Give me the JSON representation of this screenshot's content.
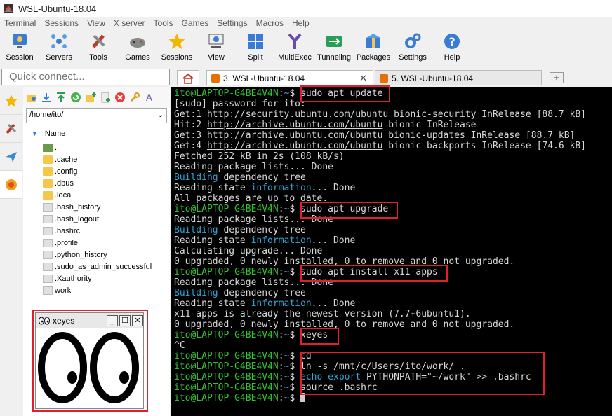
{
  "window": {
    "title": "WSL-Ubuntu-18.04"
  },
  "menu": [
    "Terminal",
    "Sessions",
    "View",
    "X server",
    "Tools",
    "Games",
    "Settings",
    "Macros",
    "Help"
  ],
  "toolbar": [
    {
      "label": "Session",
      "icon": "session-icon"
    },
    {
      "label": "Servers",
      "icon": "servers-icon"
    },
    {
      "label": "Tools",
      "icon": "tools-icon"
    },
    {
      "label": "Games",
      "icon": "games-icon"
    },
    {
      "label": "Sessions",
      "icon": "star-icon"
    },
    {
      "label": "View",
      "icon": "view-icon"
    },
    {
      "label": "Split",
      "icon": "split-icon"
    },
    {
      "label": "MultiExec",
      "icon": "multiexec-icon"
    },
    {
      "label": "Tunneling",
      "icon": "tunneling-icon"
    },
    {
      "label": "Packages",
      "icon": "packages-icon"
    },
    {
      "label": "Settings",
      "icon": "gear-icon"
    },
    {
      "label": "Help",
      "icon": "help-icon"
    }
  ],
  "quick_connect": {
    "placeholder": "Quick connect..."
  },
  "tabs": [
    {
      "label": "3. WSL-Ubuntu-18.04",
      "active": true
    },
    {
      "label": "5. WSL-Ubuntu-18.04",
      "active": false
    }
  ],
  "filebrowser": {
    "path": "/home/ito/",
    "column_header": "Name",
    "files": [
      {
        "name": "..",
        "type": "up"
      },
      {
        "name": ".cache",
        "type": "folder"
      },
      {
        "name": ".config",
        "type": "folder"
      },
      {
        "name": ".dbus",
        "type": "folder"
      },
      {
        "name": ".local",
        "type": "folder"
      },
      {
        "name": ".bash_history",
        "type": "file"
      },
      {
        "name": ".bash_logout",
        "type": "file"
      },
      {
        "name": ".bashrc",
        "type": "file"
      },
      {
        "name": ".profile",
        "type": "file"
      },
      {
        "name": ".python_history",
        "type": "file"
      },
      {
        "name": ".sudo_as_admin_successful",
        "type": "file"
      },
      {
        "name": ".Xauthority",
        "type": "file"
      },
      {
        "name": "work",
        "type": "link"
      }
    ]
  },
  "xeyes": {
    "title": "xeyes"
  },
  "terminal": {
    "prompt": "ito@LAPTOP-G4BE4V4N",
    "lines": [
      [
        {
          "t": "ito@LAPTOP-G4BE4V4N",
          "c": "green"
        },
        {
          "t": ":"
        },
        {
          "t": "~",
          "c": "blue"
        },
        {
          "t": "$ sudo apt update"
        }
      ],
      [
        {
          "t": "[sudo] password for ito:"
        }
      ],
      [
        {
          "t": "Get:1 "
        },
        {
          "t": "http://security.ubuntu.com/ubuntu",
          "c": "url"
        },
        {
          "t": " bionic-security InRelease [88.7 kB]"
        }
      ],
      [
        {
          "t": "Hit:2 "
        },
        {
          "t": "http://archive.ubuntu.com/ubuntu",
          "c": "url"
        },
        {
          "t": " bionic InRelease"
        }
      ],
      [
        {
          "t": "Get:3 "
        },
        {
          "t": "http://archive.ubuntu.com/ubuntu",
          "c": "url"
        },
        {
          "t": " bionic-updates InRelease [88.7 kB]"
        }
      ],
      [
        {
          "t": "Get:4 "
        },
        {
          "t": "http://archive.ubuntu.com/ubuntu",
          "c": "url"
        },
        {
          "t": " bionic-backports InRelease [74.6 kB]"
        }
      ],
      [
        {
          "t": "Fetched 252 kB in 2s (108 kB/s)"
        }
      ],
      [
        {
          "t": "Reading package lists... Done"
        }
      ],
      [
        {
          "t": "Building",
          "c": "cyan"
        },
        {
          "t": " dependency tree"
        }
      ],
      [
        {
          "t": "Reading state "
        },
        {
          "t": "information",
          "c": "cyan"
        },
        {
          "t": "... Done"
        }
      ],
      [
        {
          "t": "All packages are up to date."
        }
      ],
      [
        {
          "t": "ito@LAPTOP-G4BE4V4N",
          "c": "green"
        },
        {
          "t": ":"
        },
        {
          "t": "~",
          "c": "blue"
        },
        {
          "t": "$ sudo apt upgrade"
        }
      ],
      [
        {
          "t": "Reading package lists... Done"
        }
      ],
      [
        {
          "t": "Building",
          "c": "cyan"
        },
        {
          "t": " dependency tree"
        }
      ],
      [
        {
          "t": "Reading state "
        },
        {
          "t": "information",
          "c": "cyan"
        },
        {
          "t": "... Done"
        }
      ],
      [
        {
          "t": "Calculating upgrade... Done"
        }
      ],
      [
        {
          "t": "0 upgraded, 0 newly installed, 0 to remove and 0 not upgraded."
        }
      ],
      [
        {
          "t": "ito@LAPTOP-G4BE4V4N",
          "c": "green"
        },
        {
          "t": ":"
        },
        {
          "t": "~",
          "c": "blue"
        },
        {
          "t": "$ sudo apt install x11-apps"
        }
      ],
      [
        {
          "t": "Reading package lists... Done"
        }
      ],
      [
        {
          "t": "Building",
          "c": "cyan"
        },
        {
          "t": " dependency tree"
        }
      ],
      [
        {
          "t": "Reading state "
        },
        {
          "t": "information",
          "c": "cyan"
        },
        {
          "t": "... Done"
        }
      ],
      [
        {
          "t": "x11-apps is already the newest version (7.7+6ubuntu1)."
        }
      ],
      [
        {
          "t": "0 upgraded, 0 newly installed, 0 to remove and 0 not upgraded."
        }
      ],
      [
        {
          "t": "ito@LAPTOP-G4BE4V4N",
          "c": "green"
        },
        {
          "t": ":"
        },
        {
          "t": "~",
          "c": "blue"
        },
        {
          "t": "$ xeyes"
        }
      ],
      [
        {
          "t": "^C"
        }
      ],
      [
        {
          "t": "ito@LAPTOP-G4BE4V4N",
          "c": "green"
        },
        {
          "t": ":"
        },
        {
          "t": "~",
          "c": "blue"
        },
        {
          "t": "$ cd"
        }
      ],
      [
        {
          "t": "ito@LAPTOP-G4BE4V4N",
          "c": "green"
        },
        {
          "t": ":"
        },
        {
          "t": "~",
          "c": "blue"
        },
        {
          "t": "$ ln -s /mnt/c/Users/ito/work/ ."
        }
      ],
      [
        {
          "t": "ito@LAPTOP-G4BE4V4N",
          "c": "green"
        },
        {
          "t": ":"
        },
        {
          "t": "~",
          "c": "blue"
        },
        {
          "t": "$ "
        },
        {
          "t": "echo export",
          "c": "cyan"
        },
        {
          "t": " PYTHONPATH=\"~/work\" >> .bashrc"
        }
      ],
      [
        {
          "t": "ito@LAPTOP-G4BE4V4N",
          "c": "green"
        },
        {
          "t": ":"
        },
        {
          "t": "~",
          "c": "blue"
        },
        {
          "t": "$ source .bashrc"
        }
      ],
      [
        {
          "t": "ito@LAPTOP-G4BE4V4N",
          "c": "green"
        },
        {
          "t": ":"
        },
        {
          "t": "~",
          "c": "blue"
        },
        {
          "t": "$ "
        },
        {
          "t": "",
          "c": "cursor"
        }
      ]
    ]
  },
  "colors": {
    "highlight": "#e0202c",
    "prompt_green": "#34c234",
    "path_blue": "#5a90e8",
    "keyword_cyan": "#2fa8d8",
    "terminal_bg": "#000000"
  }
}
